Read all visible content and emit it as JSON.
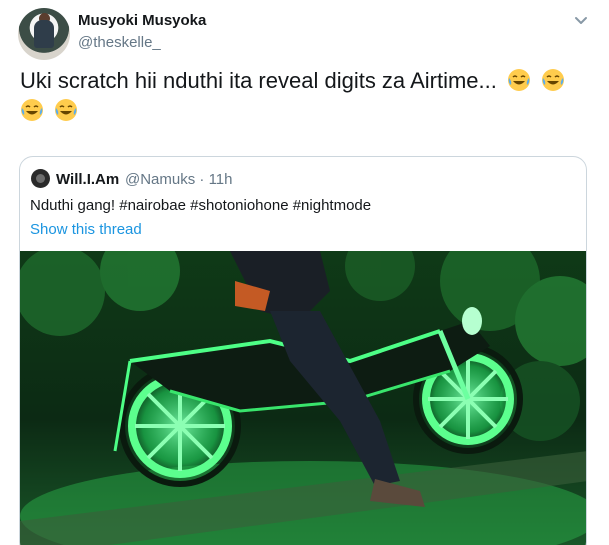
{
  "tweet": {
    "display_name": "Musyoki Musyoka",
    "handle": "@theskelle_",
    "text": "Uki scratch hii nduthi ita reveal digits za Airtime...",
    "emoji_icon": "face-with-tears-of-joy-icon",
    "emoji_count": 4
  },
  "quoted_tweet": {
    "display_name": "Will.I.Am",
    "handle_time": "@Namuks · 11h",
    "text": "Nduthi gang! #nairobae #shotoniohone #nightmode",
    "show_thread": "Show this thread",
    "image_description_icon": "motorcycle-green-neon-photo"
  },
  "colors": {
    "text": "#14171a",
    "secondary": "#657786",
    "link": "#1b95e0",
    "border": "#ccd6dd",
    "neon": "#3cff7a"
  }
}
